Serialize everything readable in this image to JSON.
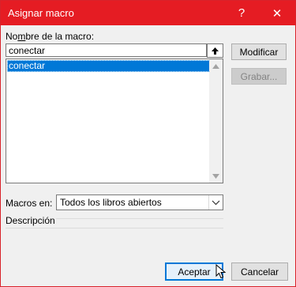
{
  "window": {
    "title": "Asignar macro",
    "help_glyph": "?",
    "close_glyph": "✕"
  },
  "macro_name": {
    "label": "Nombre de la macro:",
    "label_hotkey_index": 2,
    "value": "conectar"
  },
  "macro_list": {
    "items": [
      "conectar"
    ],
    "selected_index": 0
  },
  "buttons": {
    "modify": "Modificar",
    "record": "Grabar...",
    "accept": "Aceptar",
    "cancel": "Cancelar"
  },
  "macros_in": {
    "label": "Macros en:",
    "value": "Todos los libros abiertos"
  },
  "description": {
    "label": "Descripción"
  },
  "colors": {
    "titlebar": "#e51c23",
    "selection": "#0078d7"
  }
}
